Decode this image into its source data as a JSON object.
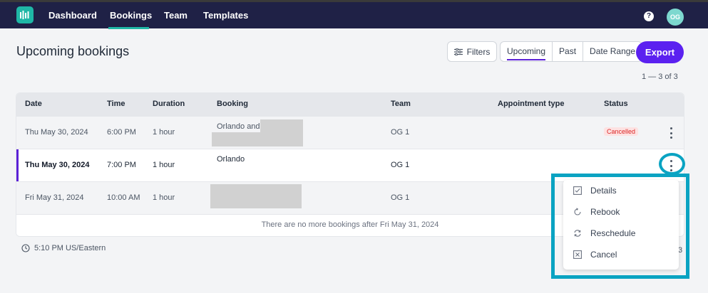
{
  "nav": {
    "items": [
      {
        "label": "Dashboard"
      },
      {
        "label": "Bookings"
      },
      {
        "label": "Team"
      },
      {
        "label": "Templates"
      }
    ],
    "active": "Bookings",
    "help": "?",
    "avatar": "OG"
  },
  "page": {
    "title": "Upcoming bookings"
  },
  "toolbar": {
    "filters_label": "Filters",
    "tabs": [
      {
        "label": "Upcoming"
      },
      {
        "label": "Past"
      },
      {
        "label": "Date Range"
      }
    ],
    "active_tab": "Upcoming",
    "export_label": "Export"
  },
  "pagination": {
    "text": "1 — 3 of 3"
  },
  "table": {
    "columns": [
      "Date",
      "Time",
      "Duration",
      "Booking",
      "Team",
      "Appointment type",
      "Status"
    ],
    "rows": [
      {
        "date": "Thu May 30, 2024",
        "time": "6:00 PM",
        "duration": "1 hour",
        "booking": "Orlando and",
        "team": "OG 1",
        "appointment_type": "",
        "status": "Cancelled"
      },
      {
        "date": "Thu May 30, 2024",
        "time": "7:00 PM",
        "duration": "1 hour",
        "booking": "Orlando",
        "team": "OG 1",
        "appointment_type": "",
        "status": ""
      },
      {
        "date": "Fri May 31, 2024",
        "time": "10:00 AM",
        "duration": "1 hour",
        "booking": "",
        "team": "OG 1",
        "appointment_type": "",
        "status": ""
      }
    ],
    "footer_note": "There are no more bookings after Fri May 31, 2024"
  },
  "timezone": {
    "label": "5:10 PM US/Eastern"
  },
  "stray_text": "3",
  "context_menu": {
    "items": [
      {
        "label": "Details",
        "icon": "checkbox-icon"
      },
      {
        "label": "Rebook",
        "icon": "rebook-icon"
      },
      {
        "label": "Reschedule",
        "icon": "refresh-icon"
      },
      {
        "label": "Cancel",
        "icon": "cancel-icon"
      }
    ]
  },
  "colors": {
    "nav_bg": "#1f2146",
    "accent": "#5b21f0",
    "teal": "#1fb7a6",
    "highlight": "#0aa3c2",
    "cancelled": "#dc2626"
  }
}
